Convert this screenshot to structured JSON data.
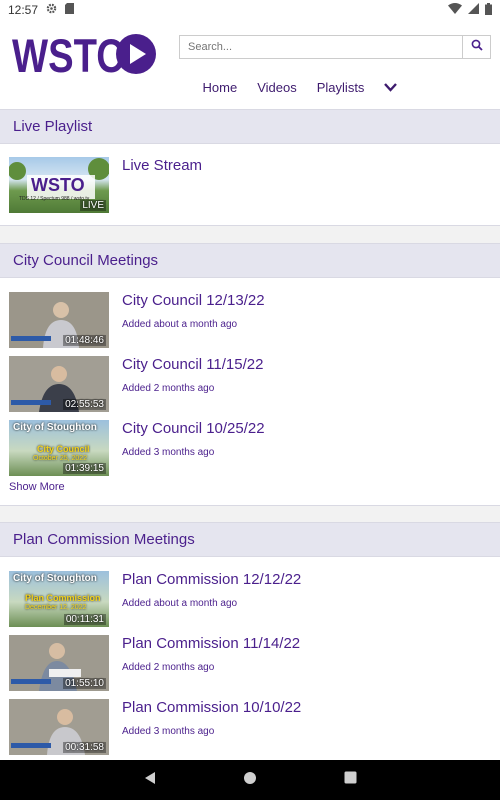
{
  "status_bar": {
    "time": "12:57"
  },
  "header": {
    "logo_text": "WSTO",
    "search_placeholder": "Search...",
    "nav": {
      "home": "Home",
      "videos": "Videos",
      "playlists": "Playlists"
    }
  },
  "live": {
    "heading": "Live Playlist",
    "item": {
      "title": "Live Stream",
      "thumb_logo": "WSTO",
      "thumb_sub": "TDS 12 / Spectum 988 / wsto.tv",
      "badge": "LIVE"
    }
  },
  "council": {
    "heading": "City Council Meetings",
    "items": [
      {
        "title": "City Council 12/13/22",
        "added": "Added about a month ago",
        "duration": "01:48:46"
      },
      {
        "title": "City Council 11/15/22",
        "added": "Added 2 months ago",
        "duration": "02:55:53"
      },
      {
        "title": "City Council 10/25/22",
        "added": "Added 3 months ago",
        "duration": "01:39:15",
        "card_line1": "City of Stoughton",
        "card_line2": "City Council",
        "card_line3": "October 25, 2022"
      }
    ],
    "show_more": "Show More"
  },
  "plan": {
    "heading": "Plan Commission Meetings",
    "items": [
      {
        "title": "Plan Commission 12/12/22",
        "added": "Added about a month ago",
        "duration": "00:11:31",
        "card_line1": "City of Stoughton",
        "card_line2": "Plan Commission",
        "card_line3": "December 12, 2022"
      },
      {
        "title": "Plan Commission 11/14/22",
        "added": "Added 2 months ago",
        "duration": "01:55:10"
      },
      {
        "title": "Plan Commission 10/10/22",
        "added": "Added 3 months ago",
        "duration": "00:31:58"
      }
    ]
  },
  "colors": {
    "brand_purple": "#4a1f8c",
    "section_header_bg": "#e5e5ef"
  },
  "icons": [
    "gear-icon",
    "sd-card-icon",
    "wifi-icon",
    "signal-icon",
    "battery-icon",
    "search-icon",
    "chevron-down-icon",
    "back-icon",
    "home-icon",
    "recents-icon"
  ]
}
